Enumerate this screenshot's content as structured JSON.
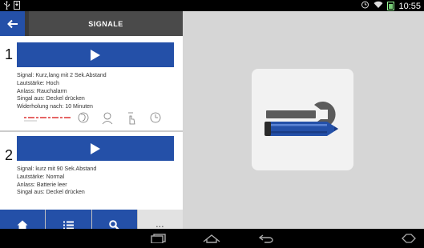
{
  "status_bar": {
    "left_icons": [
      "usb-icon",
      "download-icon"
    ],
    "right_icons": [
      "alarm-icon",
      "wifi-icon",
      "battery-icon"
    ],
    "time": "10:55"
  },
  "header": {
    "title": "SIGNALE",
    "back_icon": "back-arrow-icon"
  },
  "signals": [
    {
      "number": "1",
      "lines": [
        "Signal: Kurz,lang mit 2 Sek.Abstand",
        "Lautstärke: Hoch",
        "Anlass: Rauchalarm",
        "Singal aus: Deckel drücken",
        "Widerholung nach: 10 Minuten"
      ],
      "pictos": [
        "signal-pattern-icon",
        "ear-icon",
        "person-icon",
        "hand-press-icon",
        "clock-icon"
      ]
    },
    {
      "number": "2",
      "lines": [
        "Signal: kurz mit 90 Sek.Abstand",
        "Lautstärke: Normal",
        "Anlass: Batterie leer",
        "Singal aus: Deckel drücken"
      ]
    }
  ],
  "bottom_tabs": [
    {
      "name": "home",
      "icon": "home-icon"
    },
    {
      "name": "list",
      "icon": "list-icon"
    },
    {
      "name": "search",
      "icon": "search-icon"
    },
    {
      "name": "more",
      "label": "..."
    }
  ],
  "right_pane": {
    "tile_icon": "wrench-pencil-icon"
  },
  "nav_bar": {
    "buttons": [
      "recent-apps-icon",
      "home-icon",
      "back-icon",
      "screenshot-icon"
    ]
  },
  "colors": {
    "accent": "#2450a8",
    "header_bg": "#4a4a4a",
    "right_bg": "#d6d6d6"
  }
}
